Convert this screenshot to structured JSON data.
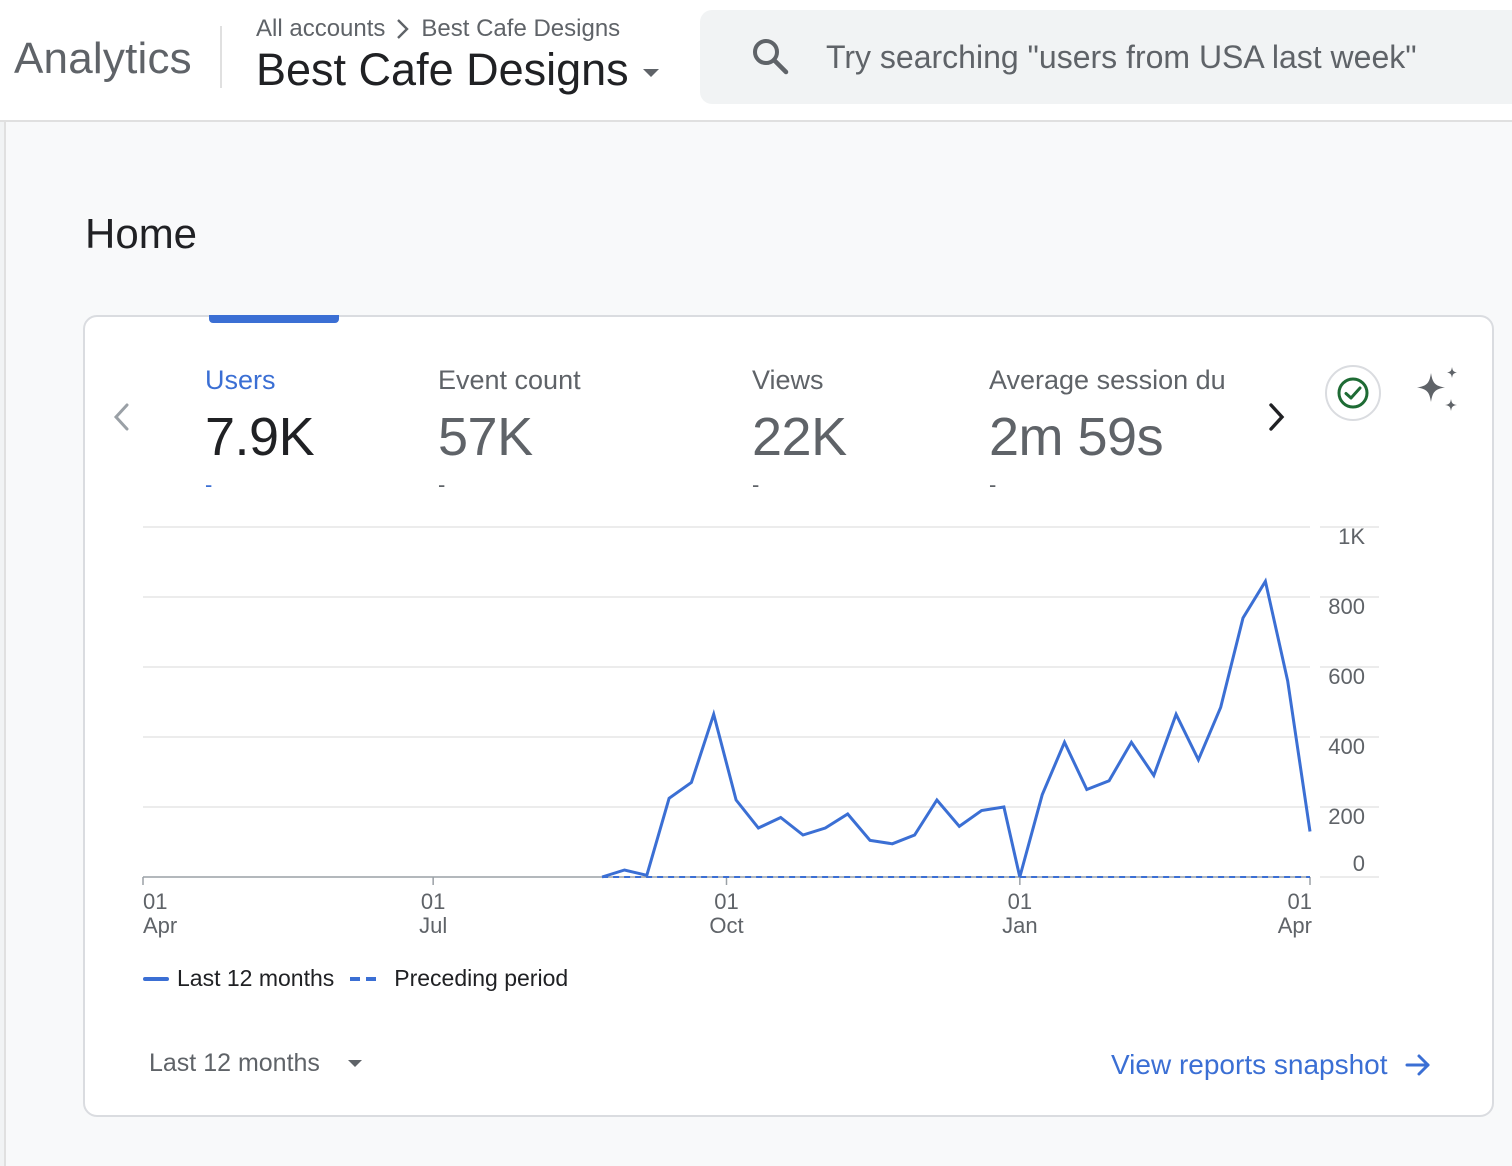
{
  "header": {
    "app_name": "Analytics",
    "breadcrumb": {
      "root": "All accounts",
      "account": "Best Cafe Designs"
    },
    "property": "Best Cafe Designs",
    "search_placeholder": "Try searching \"users from USA last week\""
  },
  "page": {
    "title": "Home"
  },
  "metrics": [
    {
      "label": "Users",
      "value": "7.9K",
      "delta": "-",
      "active": true
    },
    {
      "label": "Event count",
      "value": "57K",
      "delta": "-"
    },
    {
      "label": "Views",
      "value": "22K",
      "delta": "-"
    },
    {
      "label": "Average session du",
      "value": "2m 59s",
      "delta": "-"
    }
  ],
  "icons": [
    "chevron-left-icon",
    "chevron-right-icon",
    "check-circle-icon",
    "sparkle-icon",
    "search-icon",
    "arrow-right-icon",
    "dropdown-caret-icon"
  ],
  "colors": {
    "accent": "#3b6fd4",
    "check": "#1e6b34"
  },
  "chart_data": {
    "type": "line",
    "x_ticks": [
      {
        "day": "01",
        "month": "Apr"
      },
      {
        "day": "01",
        "month": "Jul"
      },
      {
        "day": "01",
        "month": "Oct"
      },
      {
        "day": "01",
        "month": "Jan"
      },
      {
        "day": "01",
        "month": "Apr"
      }
    ],
    "y_ticks": [
      "1K",
      "800",
      "600",
      "400",
      "200",
      "0"
    ],
    "ylim": [
      0,
      1000
    ],
    "y_axis_side": "right",
    "grid": true,
    "series": [
      {
        "name": "Last 12 months",
        "style": "solid",
        "x": [
          "2023-08-23",
          "2023-08-30",
          "2023-09-06",
          "2023-09-13",
          "2023-09-20",
          "2023-09-27",
          "2023-10-04",
          "2023-10-11",
          "2023-10-18",
          "2023-10-25",
          "2023-11-01",
          "2023-11-08",
          "2023-11-15",
          "2023-11-22",
          "2023-11-29",
          "2023-12-06",
          "2023-12-13",
          "2023-12-20",
          "2023-12-27",
          "2024-01-01",
          "2024-01-08",
          "2024-01-15",
          "2024-01-22",
          "2024-01-29",
          "2024-02-05",
          "2024-02-12",
          "2024-02-19",
          "2024-02-26",
          "2024-03-04",
          "2024-03-11",
          "2024-03-18",
          "2024-03-25",
          "2024-04-01"
        ],
        "values": [
          0,
          20,
          5,
          225,
          270,
          465,
          220,
          140,
          170,
          120,
          140,
          180,
          105,
          95,
          120,
          220,
          145,
          190,
          200,
          0,
          235,
          385,
          250,
          275,
          385,
          290,
          465,
          335,
          485,
          740,
          845,
          560,
          130
        ]
      },
      {
        "name": "Preceding period",
        "style": "dashed",
        "x": [
          "2023-08-23",
          "2024-04-01"
        ],
        "values": [
          0,
          0
        ]
      }
    ]
  },
  "legend": {
    "current": "Last 12 months",
    "previous": "Preceding period"
  },
  "footer": {
    "range_label": "Last 12 months",
    "snapshot_link": "View reports snapshot"
  }
}
